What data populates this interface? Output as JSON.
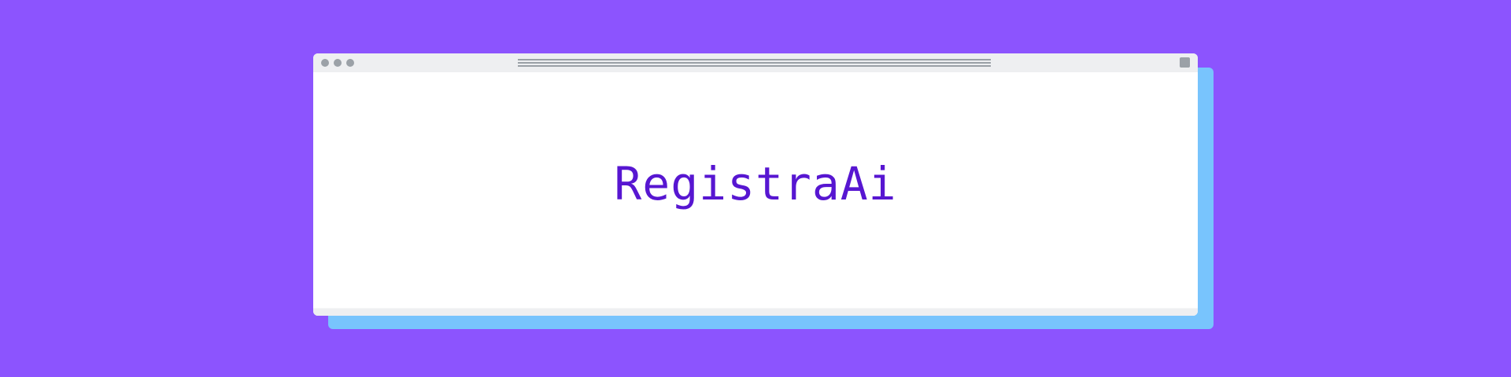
{
  "colors": {
    "background": "#8c54fe",
    "shadow_card": "#78c4fd",
    "window": "#ffffff",
    "title_bar": "#eeeff1",
    "window_controls": "#9ba1a7",
    "brand_text": "#5716d1"
  },
  "window": {
    "controls": [
      "dot-icon",
      "dot-icon",
      "dot-icon"
    ],
    "address_bar_icon": "address-lines",
    "window_button_icon": "square-icon"
  },
  "content": {
    "brand_title": "RegistraAi"
  }
}
